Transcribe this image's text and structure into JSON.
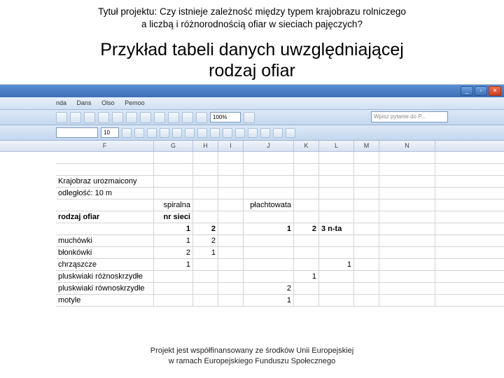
{
  "header": {
    "project_title_l1": "Tytuł projektu: Czy istnieje zależność między typem krajobrazu rolniczego",
    "project_title_l2": "a liczbą i różnorodnością ofiar w sieciach pajęczych?"
  },
  "main_title_l1": "Przykład tabeli danych uwzględniającej",
  "main_title_l2": "rodzaj ofiar",
  "app": {
    "menu": {
      "m1": "nda",
      "m2": "Dans",
      "m3": "Olso",
      "m4": "Pemoo"
    },
    "zoom": "100%",
    "question_hint": "Wpisz pytanie do P...",
    "font_size": "10",
    "win_min": "_",
    "win_max": "▫",
    "win_close": "✕"
  },
  "columns": {
    "F": "F",
    "G": "G",
    "H": "H",
    "I": "I",
    "J": "J",
    "K": "K",
    "L": "L",
    "M": "M",
    "N": "N"
  },
  "table": {
    "landscape": "Krajobraz urozmaicony",
    "distance": "odległość: 10 m",
    "header_spiralna": "spiralna",
    "header_plachtowata": "płachtowata",
    "rodzaj_ofiar": "rodzaj ofiar",
    "nr_sieci": "nr sieci",
    "nr_1": "1",
    "nr_2": "2",
    "nr_k1": "1",
    "nr_k2": "2",
    "nr_nta": "3 n-ta",
    "rows": {
      "muchowki": "muchówki",
      "blonkowki": "błonkówki",
      "chrzaszcze": "chrząszcze",
      "pluskwiaki_r": "pluskwiaki różnoskrzydłe",
      "pluskwiaki_w": "pluskwiaki równoskrzydłe",
      "motyle": "motyle"
    }
  },
  "chart_data": {
    "type": "table",
    "title": "Krajobraz urozmaicony, odległość: 10 m",
    "column_groups": [
      {
        "name": "spiralna",
        "net_numbers": [
          "1",
          "2"
        ]
      },
      {
        "name": "płachtowata",
        "net_numbers": [
          "1",
          "2",
          "3 n-ta"
        ]
      }
    ],
    "row_label": "rodzaj ofiar",
    "col_label": "nr sieci",
    "rows": [
      {
        "label": "muchówki",
        "values": [
          1,
          2,
          null,
          null,
          null
        ]
      },
      {
        "label": "błonkówki",
        "values": [
          2,
          1,
          null,
          null,
          null
        ]
      },
      {
        "label": "chrząszcze",
        "values": [
          1,
          null,
          null,
          null,
          1
        ]
      },
      {
        "label": "pluskwiaki różnoskrzydłe",
        "values": [
          null,
          null,
          null,
          1,
          null
        ]
      },
      {
        "label": "pluskwiaki równoskrzydłe",
        "values": [
          null,
          null,
          2,
          null,
          null
        ]
      },
      {
        "label": "motyle",
        "values": [
          null,
          null,
          1,
          null,
          null
        ]
      }
    ]
  },
  "footer": {
    "l1": "Projekt jest współfinansowany ze środków Unii Europejskiej",
    "l2": "w ramach Europejskiego Funduszu Społecznego"
  }
}
